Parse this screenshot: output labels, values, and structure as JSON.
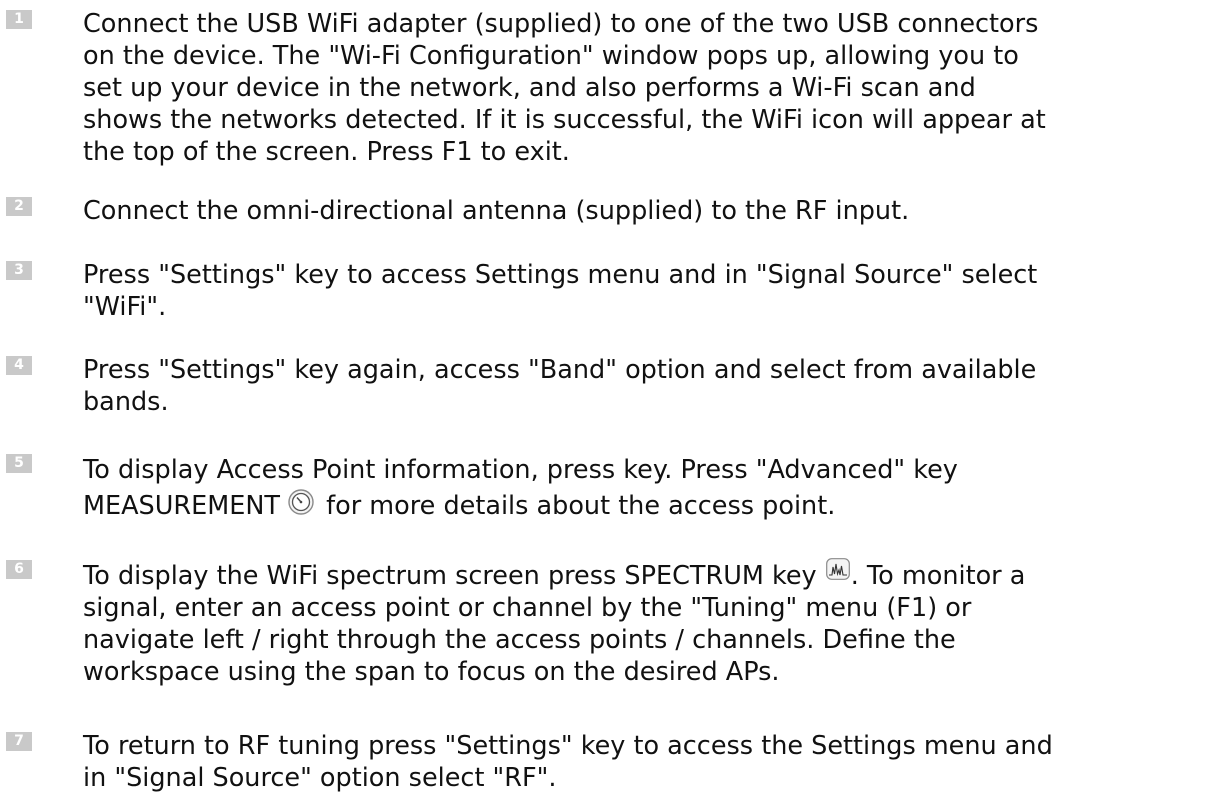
{
  "steps": [
    {
      "number": "1",
      "lines": [
        "Connect the USB WiFi adapter (supplied) to one of the two USB connectors",
        "on the device. The \"Wi-Fi Configuration\" window pops up, allowing you to",
        "set up your device in the network, and also performs a Wi-Fi scan and",
        "shows the networks detected. If it is successful, the WiFi icon will appear at",
        "the top of the screen. Press F1 to exit."
      ]
    },
    {
      "number": "2",
      "lines": [
        "Connect the omni-directional antenna (supplied) to the RF input."
      ]
    },
    {
      "number": "3",
      "lines": [
        "Press \"Settings\" key to access Settings menu and in \"Signal Source\" select",
        "\"WiFi\"."
      ]
    },
    {
      "number": "4",
      "lines": [
        "Press \"Settings\" key again, access \"Band\" option and select from available",
        "bands."
      ]
    },
    {
      "number": "5",
      "line1": "To display Access Point information, press key. Press \"Advanced\" key",
      "line2_before": "MEASUREMENT",
      "line2_after": " for more details about the access point.",
      "icon": "measurement-gauge-icon"
    },
    {
      "number": "6",
      "line1_before": "To display the WiFi spectrum screen press SPECTRUM key ",
      "line1_after": ". To monitor a",
      "icon": "spectrum-icon",
      "lines_rest": [
        "signal, enter an access point or channel by the \"Tuning\" menu (F1) or",
        "navigate left / right through the access points / channels. Define the",
        "workspace using the span to focus on the desired APs."
      ]
    },
    {
      "number": "7",
      "lines": [
        "To return to RF tuning press \"Settings\" key to access the Settings menu and",
        "in \"Signal Source\" option select \"RF\"."
      ]
    }
  ],
  "colors": {
    "badge": "#c9c9c9",
    "text": "#111111"
  }
}
